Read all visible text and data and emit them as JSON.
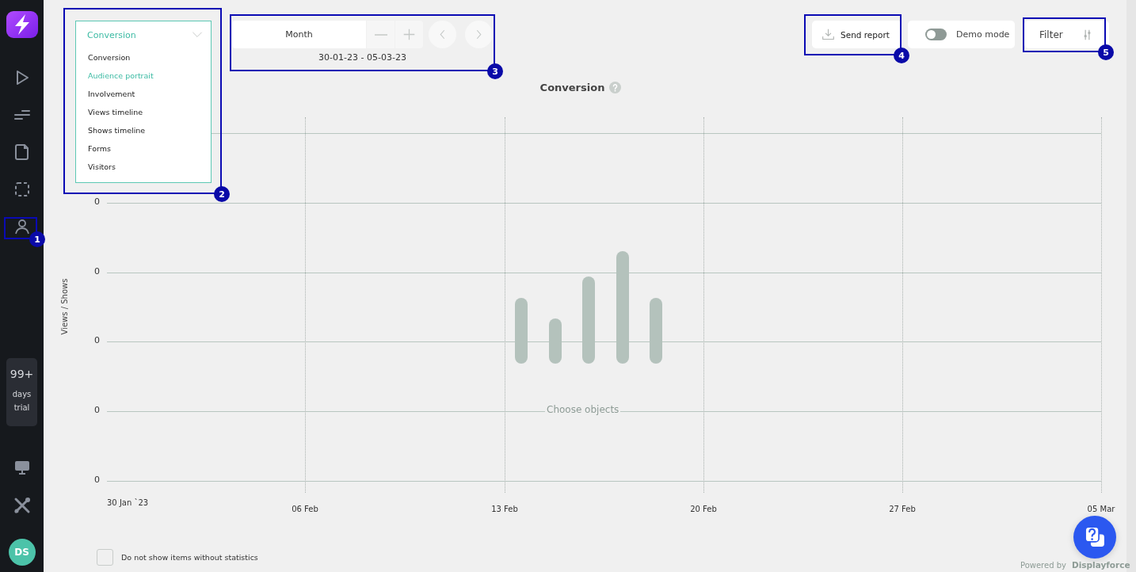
{
  "sidebar": {
    "nav": [
      {
        "kind": "play"
      },
      {
        "kind": "sliders"
      },
      {
        "kind": "document"
      },
      {
        "kind": "dashed-square"
      },
      {
        "kind": "user"
      }
    ],
    "trial": {
      "count": "99+",
      "line1": "days",
      "line2": "trial"
    },
    "bottom_nav": [
      {
        "kind": "monitor"
      },
      {
        "kind": "tools"
      }
    ],
    "avatar": "DS"
  },
  "report_select": {
    "value": "Conversion",
    "expanded": true,
    "options": [
      {
        "label": "Conversion",
        "highlighted": false
      },
      {
        "label": "Audience portrait",
        "highlighted": true
      },
      {
        "label": "Involvement",
        "highlighted": false
      },
      {
        "label": "Views timeline",
        "highlighted": false
      },
      {
        "label": "Shows timeline",
        "highlighted": false
      },
      {
        "label": "Forms",
        "highlighted": false
      },
      {
        "label": "Visitors",
        "highlighted": false
      }
    ]
  },
  "period": {
    "unit": "Month",
    "range": "30-01-23 - 05-03-23"
  },
  "actions": {
    "send_report": "Send report",
    "demo_mode": {
      "label": "Demo mode",
      "on": false
    },
    "filter": "Filter"
  },
  "chart": {
    "title": "Conversion",
    "ylabel": "Views / Shows",
    "y_ticks": [
      "0",
      "0",
      "0",
      "0",
      "0"
    ],
    "x_ticks": [
      "30 Jan `23",
      "06 Feb",
      "13 Feb",
      "20 Feb",
      "27 Feb",
      "05 Mar"
    ],
    "placeholder": "Choose objects"
  },
  "footer": {
    "checkbox": {
      "label": "Do not show items without statistics",
      "checked": false
    },
    "powered_by": "Powered by",
    "brand": "Displayforce"
  },
  "callouts": [
    {
      "label": "1"
    },
    {
      "label": "2"
    },
    {
      "label": "3"
    },
    {
      "label": "4"
    },
    {
      "label": "5"
    }
  ]
}
